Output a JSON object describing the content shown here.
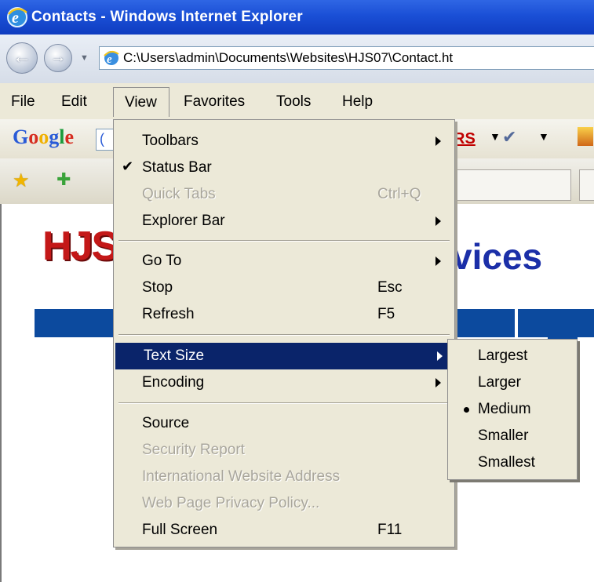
{
  "window": {
    "title": "Contacts - Windows Internet Explorer",
    "address": "C:\\Users\\admin\\Documents\\Websites\\HJS07\\Contact.ht"
  },
  "menubar": {
    "items": [
      "File",
      "Edit",
      "View",
      "Favorites",
      "Tools",
      "Help"
    ],
    "active": "View"
  },
  "google_toolbar": {
    "logo": "Google",
    "search_partial": "(",
    "rs_text": "RS"
  },
  "page": {
    "logo_text": "HJS",
    "heading_fragment": "vices"
  },
  "view_menu": {
    "items": [
      {
        "label": "Toolbars",
        "shortcut": "",
        "submenu": true
      },
      {
        "label": "Status Bar",
        "shortcut": "",
        "checked": true
      },
      {
        "label": "Quick Tabs",
        "shortcut": "Ctrl+Q",
        "disabled": true
      },
      {
        "label": "Explorer Bar",
        "shortcut": "",
        "submenu": true
      },
      {
        "label": "Go To",
        "shortcut": "",
        "submenu": true
      },
      {
        "label": "Stop",
        "shortcut": "Esc"
      },
      {
        "label": "Refresh",
        "shortcut": "F5"
      },
      {
        "label": "Text Size",
        "shortcut": "",
        "submenu": true,
        "highlighted": true
      },
      {
        "label": "Encoding",
        "shortcut": "",
        "submenu": true
      },
      {
        "label": "Source",
        "shortcut": ""
      },
      {
        "label": "Security Report",
        "shortcut": "",
        "disabled": true
      },
      {
        "label": "International Website Address",
        "shortcut": "",
        "disabled": true
      },
      {
        "label": "Web Page Privacy Policy...",
        "shortcut": "",
        "disabled": true
      },
      {
        "label": "Full Screen",
        "shortcut": "F11"
      }
    ]
  },
  "text_size_menu": {
    "items": [
      "Largest",
      "Larger",
      "Medium",
      "Smaller",
      "Smallest"
    ],
    "selected": "Medium"
  },
  "colors": {
    "titlebar": "#1a4fd6",
    "menu_bg": "#ece9d8",
    "highlight": "#0a246a",
    "nav_strip": "#0c4a9e",
    "logo_red": "#c41818",
    "heading_blue": "#1b2fa8"
  }
}
